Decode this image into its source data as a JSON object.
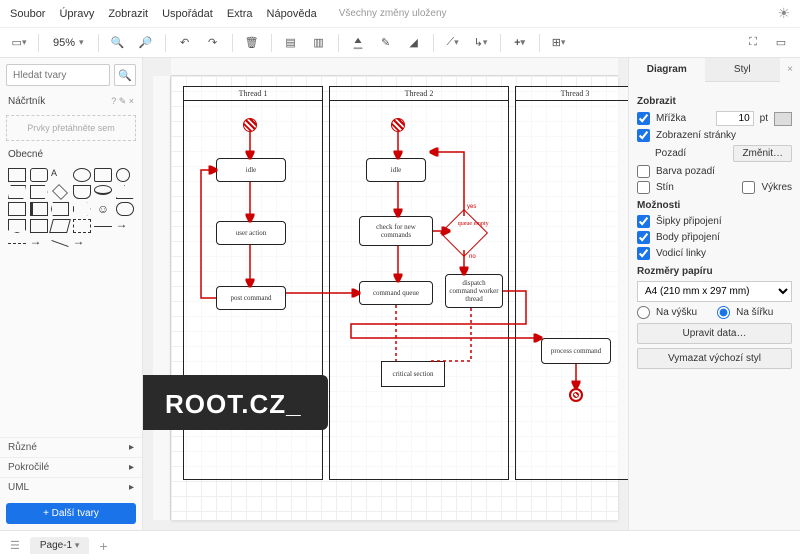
{
  "menu": {
    "items": [
      "Soubor",
      "Úpravy",
      "Zobrazit",
      "Uspořádat",
      "Extra",
      "Nápověda"
    ],
    "save_status": "Všechny změny uloženy"
  },
  "toolbar": {
    "zoom": "95%"
  },
  "left": {
    "search_placeholder": "Hledat tvary",
    "scratchpad": {
      "heading": "Náčrtník",
      "hint": "Prvky přetáhněte sem",
      "controls": "?  ✎  ×"
    },
    "general_heading": "Obecné",
    "categories": [
      "Různé",
      "Pokročilé",
      "UML"
    ],
    "more_shapes": "+ Další tvary"
  },
  "diagram": {
    "lanes": {
      "t1": "Thread 1",
      "t2": "Thread 2",
      "t3": "Thread 3"
    },
    "nodes": {
      "t1_idle": "idle",
      "t1_ua": "user action",
      "t1_post": "post command",
      "t2_idle": "idle",
      "t2_check": "check for new commands",
      "t2_queue": "command queue",
      "t2_dispatch": "dispatch command worker thread",
      "t2_crit": "critical section",
      "t2_decision": "queue empty",
      "t2_yes": "yes",
      "t2_no": "no",
      "t3_proc": "process command"
    }
  },
  "right": {
    "tabs": {
      "diagram": "Diagram",
      "style": "Styl"
    },
    "view_heading": "Zobrazit",
    "grid": "Mřížka",
    "grid_size": "10",
    "grid_unit": "pt",
    "page_view": "Zobrazení stránky",
    "background": "Pozadí",
    "change": "Změnit…",
    "bgcolor": "Barva pozadí",
    "shadow": "Stín",
    "sketch": "Výkres",
    "options_heading": "Možnosti",
    "conn_arrows": "Šipky připojení",
    "conn_points": "Body připojení",
    "guides": "Vodicí linky",
    "paper_heading": "Rozměry papíru",
    "paper_size": "A4 (210 mm x 297 mm)",
    "portrait": "Na výšku",
    "landscape": "Na šířku",
    "edit_data": "Upravit data…",
    "reset_style": "Vymazat výchozí styl"
  },
  "footer": {
    "page": "Page-1"
  },
  "watermark": "ROOT.CZ"
}
